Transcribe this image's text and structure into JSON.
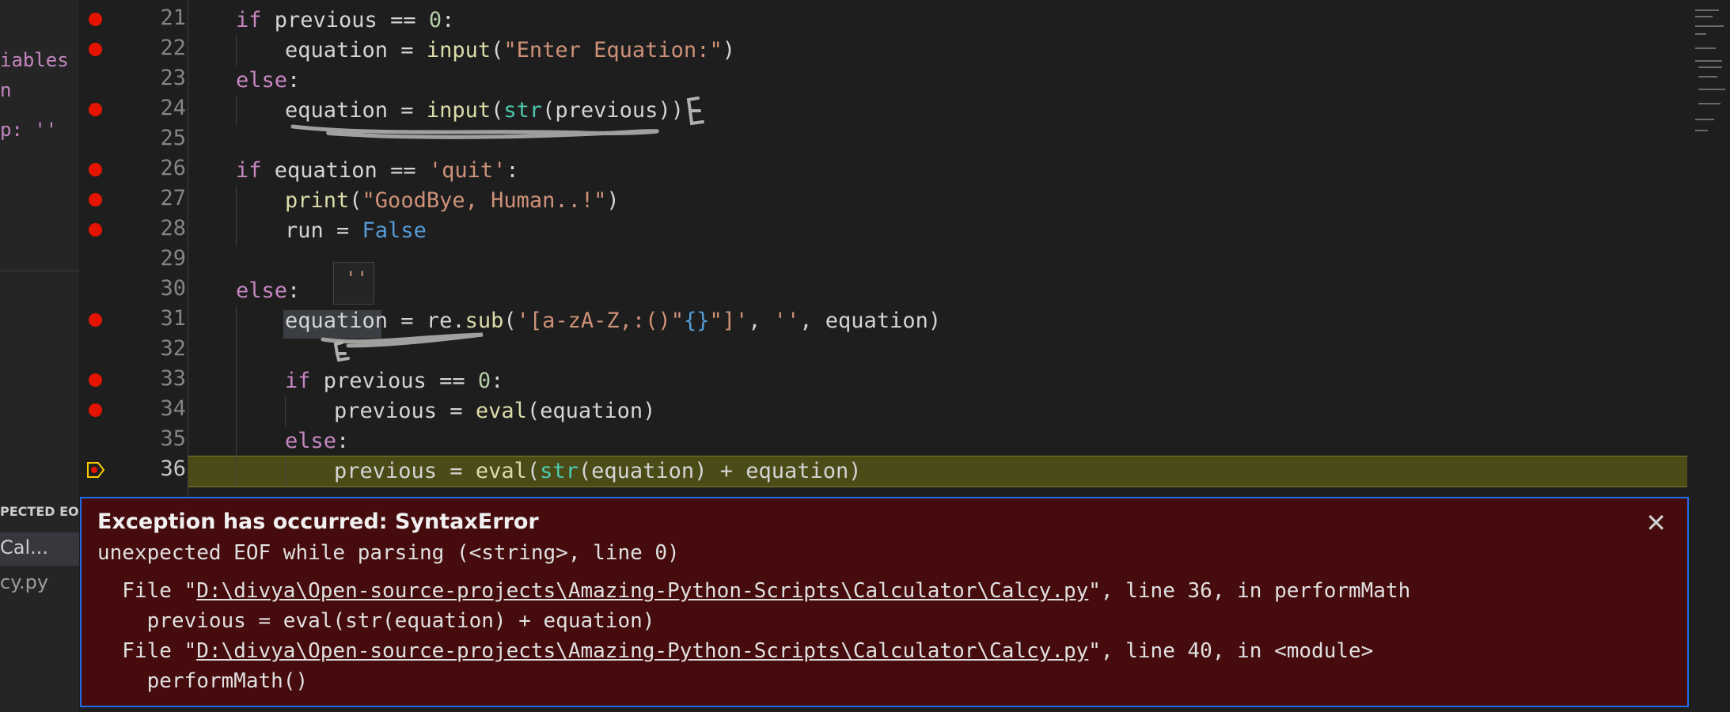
{
  "sidebar": {
    "variables_partial": "iables",
    "var_partial_1": "n",
    "var_partial_2": "p: ''",
    "callstack_header": "PECTED EO...",
    "callstack_item_1": "Cal...",
    "callstack_item_2": "cy.py"
  },
  "editor": {
    "current_line": "36",
    "hover_value": "''",
    "lines": [
      {
        "n": "21"
      },
      {
        "n": "22"
      },
      {
        "n": "23"
      },
      {
        "n": "24"
      },
      {
        "n": "25"
      },
      {
        "n": "26"
      },
      {
        "n": "27"
      },
      {
        "n": "28"
      },
      {
        "n": "29"
      },
      {
        "n": "30"
      },
      {
        "n": "31"
      },
      {
        "n": "32"
      },
      {
        "n": "33"
      },
      {
        "n": "34"
      },
      {
        "n": "35"
      },
      {
        "n": "36"
      }
    ],
    "code": {
      "l21": {
        "kw": "if",
        "var": " previous ",
        "op": "== ",
        "num": "0",
        "end": ":"
      },
      "l22": {
        "var": "equation = ",
        "fn": "input",
        "open": "(",
        "str": "\"Enter Equation:\"",
        "close": ")"
      },
      "l23": {
        "kw": "else",
        "end": ":"
      },
      "l24": {
        "var": "equation = ",
        "fn": "input",
        "open": "(",
        "bi": "str",
        "rest": "(previous))"
      },
      "l26": {
        "kw": "if",
        "var": " equation == ",
        "str": "'quit'",
        "end": ":"
      },
      "l27": {
        "fn": "print",
        "open": "(",
        "str": "\"GoodBye, Human..!\"",
        "close": ")"
      },
      "l28": {
        "var": "run = ",
        "const": "False"
      },
      "l30": {
        "kw": "else",
        "end": ":"
      },
      "l31": {
        "var": "equation = re.",
        "fn": "sub",
        "open": "(",
        "str1": "'[a-zA-Z,:()\"",
        "br": "{}",
        "str2": "\"]'",
        "mid": ", ",
        "str3": "''",
        "rest": ", equation)"
      },
      "l33": {
        "kw": "if",
        "var": " previous == ",
        "num": "0",
        "end": ":"
      },
      "l34": {
        "var": "previous = ",
        "fn": "eval",
        "rest": "(equation)"
      },
      "l35": {
        "kw": "else",
        "end": ":"
      },
      "l36": {
        "var": "previous = ",
        "fn": "eval",
        "open": "(",
        "bi": "str",
        "rest": "(equation) + equation)"
      }
    }
  },
  "exception": {
    "title": "Exception has occurred: SyntaxError",
    "message": "unexpected EOF while parsing (<string>, line 0)",
    "frames": [
      {
        "prefix": "  File \"",
        "path": "D:\\divya\\Open-source-projects\\Amazing-Python-Scripts\\Calculator\\Calcy.py",
        "suffix": "\", line 36, in performMath",
        "code": "    previous = eval(str(equation) + equation)"
      },
      {
        "prefix": "  File \"",
        "path": "D:\\divya\\Open-source-projects\\Amazing-Python-Scripts\\Calculator\\Calcy.py",
        "suffix": "\", line 40, in <module>",
        "code": "    performMath()"
      }
    ],
    "close_label": "✕"
  },
  "colors": {
    "breakpoint": "#e51400",
    "current_line_bg": "#4b4b18",
    "exception_bg": "#460b0d",
    "focus_border": "#1f6feb"
  }
}
